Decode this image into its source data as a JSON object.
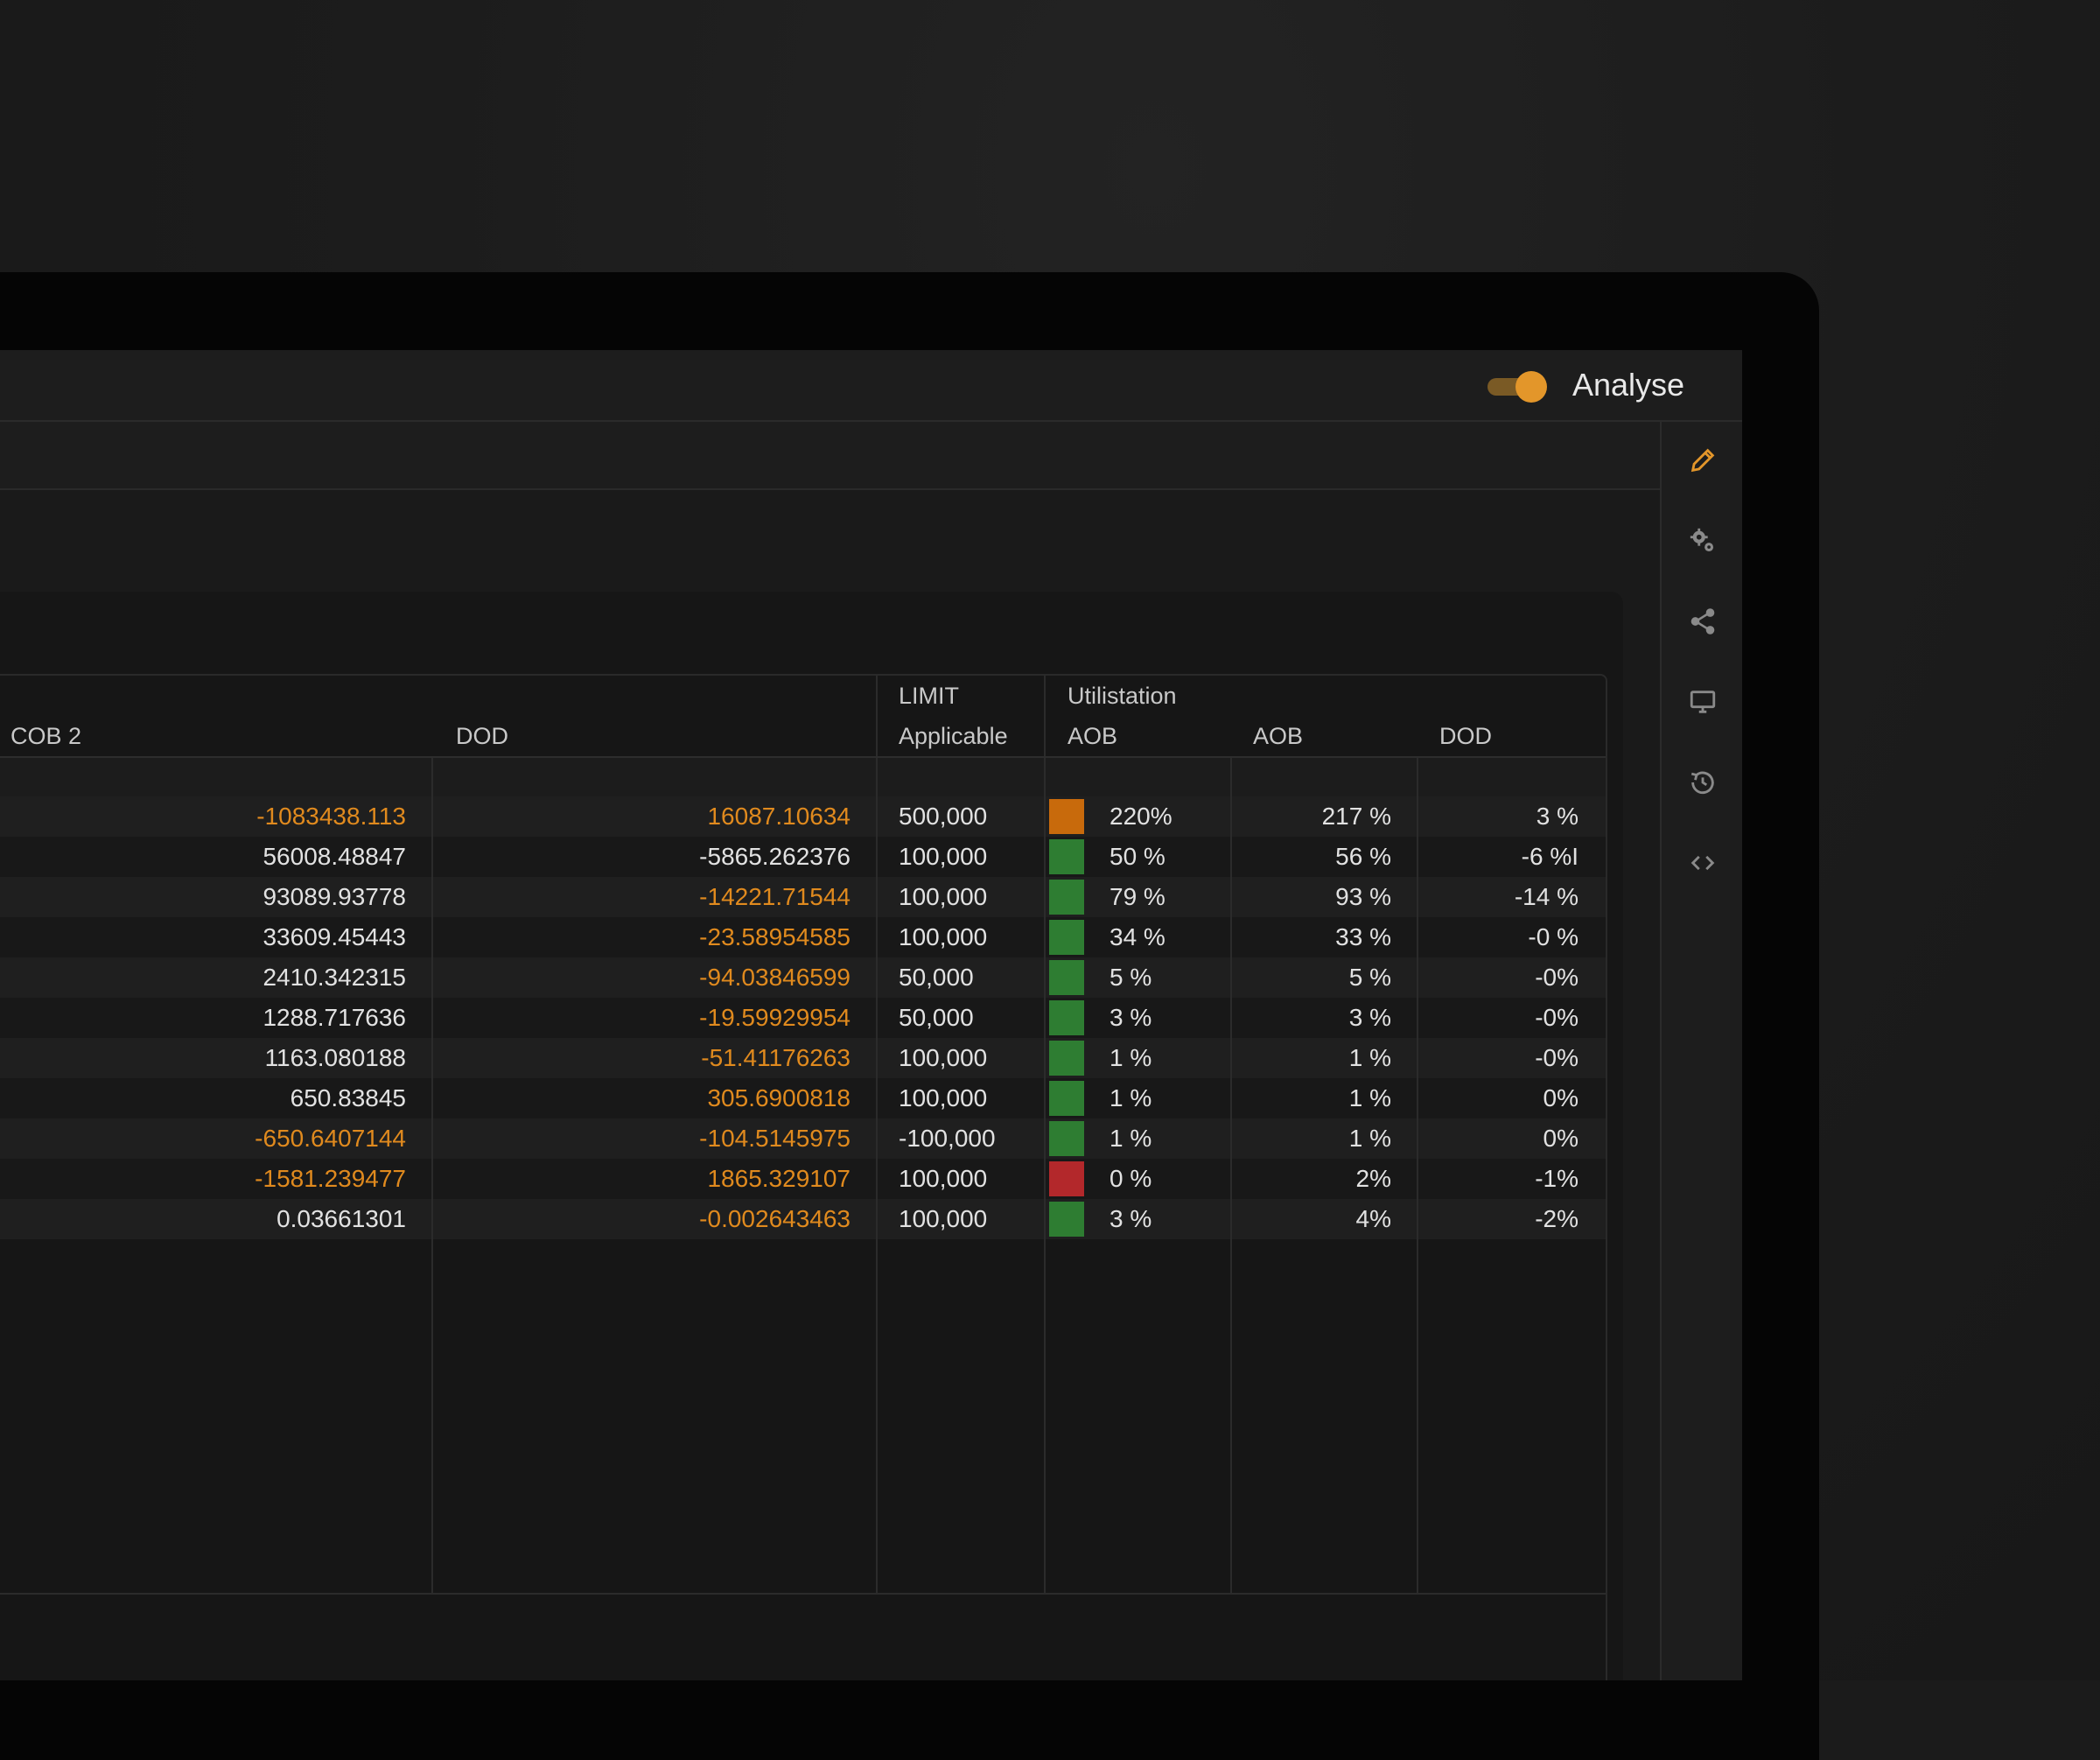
{
  "header": {
    "toggle_label": "Analyse",
    "toggle_on": true,
    "accent_color": "#e3962a"
  },
  "rail_icons": [
    "pencil-icon",
    "gears-icon",
    "share-icon",
    "monitor-icon",
    "history-icon",
    "code-icon"
  ],
  "table": {
    "columns": {
      "cob2": "COB 2",
      "dod": "DOD",
      "limit_top": "LIMIT",
      "limit_bottom": "Applicable",
      "util_top": "Utilistation",
      "util_aob": "AOB",
      "aob": "AOB",
      "dod2": "DOD"
    },
    "status_colors": {
      "orange": "#c86a0c",
      "green": "#2e7d32",
      "red": "#b3282b"
    },
    "rows": [
      {
        "cob2": "-1083438.113",
        "cob2_neg": true,
        "dod": "16087.10634",
        "dod_orange": true,
        "limit": "500,000",
        "status": "orange",
        "util_aob": "220%",
        "aob": "217 %",
        "dod2": "3 %"
      },
      {
        "cob2": "56008.48847",
        "cob2_neg": false,
        "dod": "-5865.262376",
        "dod_orange": false,
        "limit": "100,000",
        "status": "green",
        "util_aob": "50 %",
        "aob": "56 %",
        "dod2": "-6 %I"
      },
      {
        "cob2": "93089.93778",
        "cob2_neg": false,
        "dod": "-14221.71544",
        "dod_orange": true,
        "limit": "100,000",
        "status": "green",
        "util_aob": "79 %",
        "aob": "93 %",
        "dod2": "-14 %"
      },
      {
        "cob2": "33609.45443",
        "cob2_neg": false,
        "dod": "-23.58954585",
        "dod_orange": true,
        "limit": "100,000",
        "status": "green",
        "util_aob": "34 %",
        "aob": "33 %",
        "dod2": "-0 %"
      },
      {
        "cob2": "2410.342315",
        "cob2_neg": false,
        "dod": "-94.03846599",
        "dod_orange": true,
        "limit": "50,000",
        "status": "green",
        "util_aob": "5 %",
        "aob": "5 %",
        "dod2": "-0%"
      },
      {
        "cob2": "1288.717636",
        "cob2_neg": false,
        "dod": "-19.59929954",
        "dod_orange": true,
        "limit": "50,000",
        "status": "green",
        "util_aob": "3 %",
        "aob": "3 %",
        "dod2": "-0%"
      },
      {
        "cob2": "1163.080188",
        "cob2_neg": false,
        "dod": "-51.41176263",
        "dod_orange": true,
        "limit": "100,000",
        "status": "green",
        "util_aob": "1 %",
        "aob": "1 %",
        "dod2": "-0%"
      },
      {
        "cob2": "650.83845",
        "cob2_neg": false,
        "dod": "305.6900818",
        "dod_orange": true,
        "limit": "100,000",
        "status": "green",
        "util_aob": "1 %",
        "aob": "1 %",
        "dod2": "0%"
      },
      {
        "cob2": "-650.6407144",
        "cob2_neg": true,
        "dod": "-104.5145975",
        "dod_orange": true,
        "limit": "-100,000",
        "status": "green",
        "util_aob": "1 %",
        "aob": "1 %",
        "dod2": "0%"
      },
      {
        "cob2": "-1581.239477",
        "cob2_neg": true,
        "dod": "1865.329107",
        "dod_orange": true,
        "limit": "100,000",
        "status": "red",
        "util_aob": "0 %",
        "aob": "2%",
        "dod2": "-1%"
      },
      {
        "cob2": "0.03661301",
        "cob2_neg": false,
        "dod": "-0.002643463",
        "dod_orange": true,
        "limit": "100,000",
        "status": "green",
        "util_aob": "3 %",
        "aob": "4%",
        "dod2": "-2%"
      }
    ]
  }
}
